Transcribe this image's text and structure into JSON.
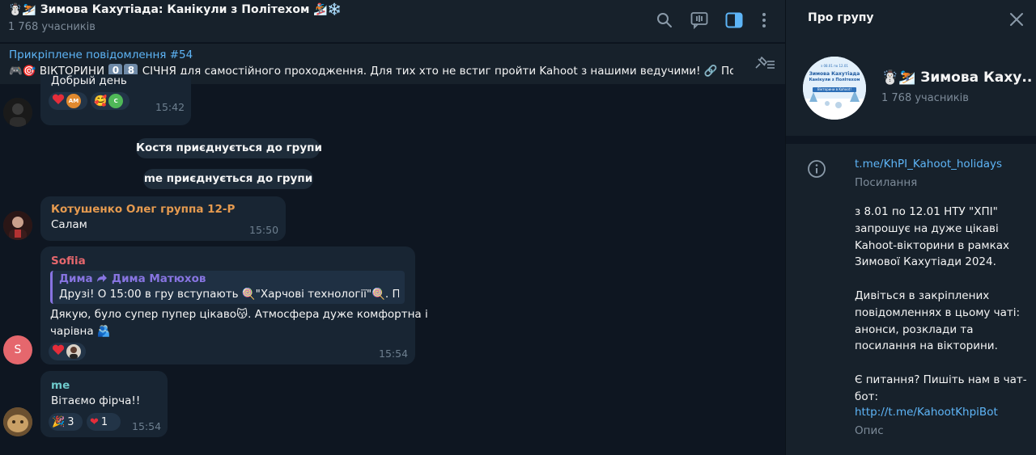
{
  "chat": {
    "title": "☃️⛷️ Зимова Кахутіада: Канікули з Політехом 🏂❄️",
    "members": "1 768 учасників",
    "pinned": {
      "title": "Прикріплене повідомлення #54",
      "prefix": "🎮🎯 ВІКТОРИНИ",
      "digit1": "0",
      "digit2": "8",
      "suffix": "СІЧНЯ для самостійного проходження.  Для тих хто не встиг пройти Kahoot з нашими ведучими! 🔗 Поси..."
    },
    "messages": {
      "m1": {
        "text": "Добрый день",
        "time": "15:42",
        "r1_initials": "AM",
        "r2_emoji": "🥰",
        "r2_initials": "C"
      },
      "service1": "Костя приєднується до групи",
      "service2": "me приєднується до групи",
      "m2": {
        "sender": "Котушенко Олег группа 12-Р",
        "text": "Салам",
        "time": "15:50"
      },
      "m3": {
        "sender": "Sofiia",
        "avatar_letter": "S",
        "reply_from": "Дима",
        "reply_to": "Дима Матюхов",
        "reply_text": "Друзі! О 15:00 в гру вступають 🍭\"Харчові технології\"🍭.  П...",
        "line1": "Дякую, було супер пупер цікаво😽. Атмосфера дуже комфортна і",
        "line2": "чарівна 🫂",
        "time": "15:54"
      },
      "m4": {
        "sender": "me",
        "text": "Вітаємо фірча!!",
        "r1_emoji": "🎉",
        "r1_count": "3",
        "r2_emoji": "❤",
        "r2_count": "1",
        "time": "15:54"
      }
    }
  },
  "panel": {
    "title": "Про групу",
    "group_name": "☃️⛷️ Зимова Каху...",
    "members": "1 768 учасників",
    "photo_line1": "з 08.01 по 12.01",
    "photo_line2": "Зимова Кахутіада",
    "photo_line3": "Канікули з Політехом",
    "photo_line4": "Вікторини в Kahoot!",
    "link": "t.me/KhPI_Kahoot_holidays",
    "link_label": "Посилання",
    "description": "з 8.01 по 12.01 НТУ \"ХПІ\"\nзапрошує на дуже цікаві\nKahoot-вікторини в рамках\nЗимової Кахутіади 2024.\n\nДивіться в закріплених\nповідомленнях в цьому чаті:\nанонси, розклади та\nпосилання на вікторини.\n\nЄ питання? Пишіть нам в чат-\nбот:",
    "bot_link": "http://t.me/KahootKhpiBot",
    "desc_label": "Опис"
  },
  "colors": {
    "accent": "#5eb5f7",
    "bubble": "#182533",
    "background": "#0e1621",
    "panel": "#17212b",
    "sender_orange": "#e59a4f",
    "sender_red": "#e5676d",
    "sender_cyan": "#6ec9cb",
    "reply_purple": "#8774e1"
  },
  "icons": [
    "search-icon",
    "live-chat-icon",
    "sidebar-toggle-icon",
    "more-vert-icon",
    "pin-list-icon",
    "close-icon",
    "info-icon",
    "heart-icon"
  ]
}
